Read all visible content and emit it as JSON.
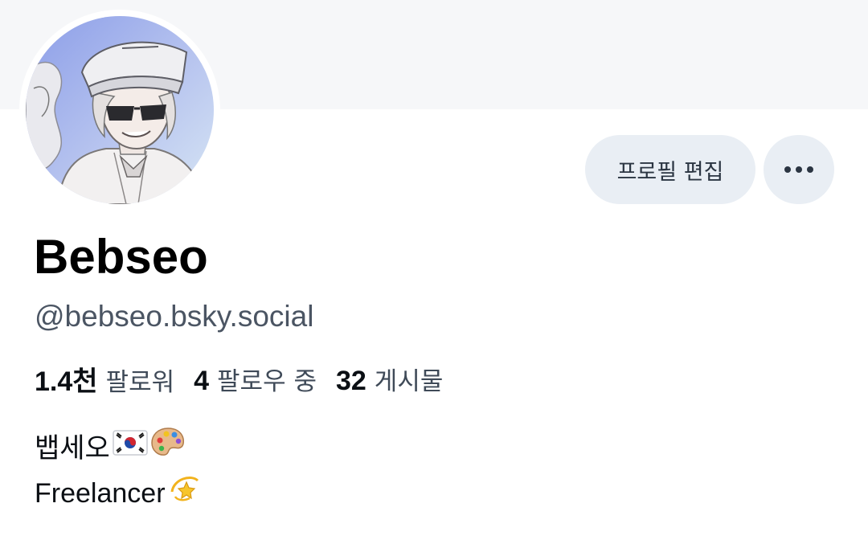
{
  "profile": {
    "display_name": "Bebseo",
    "handle": "@bebseo.bsky.social",
    "avatar_icon": "profile-avatar-illustration"
  },
  "actions": {
    "edit_label": "프로필 편집",
    "more_icon": "more-horizontal-icon"
  },
  "stats": {
    "followers_count": "1.4천",
    "followers_label": "팔로워",
    "following_count": "4",
    "following_label": "팔로우 중",
    "posts_count": "32",
    "posts_label": "게시물"
  },
  "bio": {
    "line1_text": "뱁세오",
    "line1_emojis": [
      "korea-flag-emoji",
      "artist-palette-emoji"
    ],
    "line2_text": "Freelancer",
    "line2_emojis": [
      "dizzy-star-emoji"
    ]
  },
  "colors": {
    "banner": "#f6f7f9",
    "button_bg": "#e9eef4",
    "handle_text": "#4b5563"
  }
}
